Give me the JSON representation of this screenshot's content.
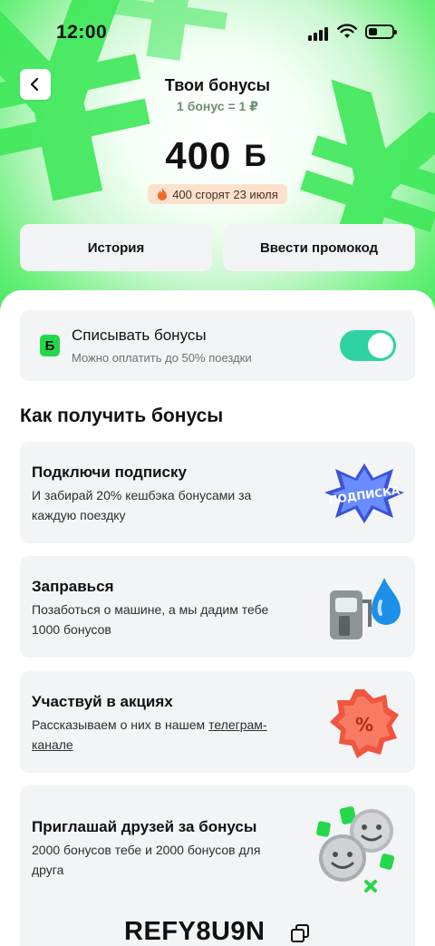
{
  "status_bar": {
    "time": "12:00"
  },
  "header": {
    "title": "Твои бонусы",
    "rate": "1 бонус = 1 ₽",
    "balance_amount": "400",
    "balance_currency": "Б",
    "expire_text": "400 сгорят 23 июля"
  },
  "actions": {
    "history": "История",
    "promocode": "Ввести промокод"
  },
  "toggle": {
    "title": "Списывать бонусы",
    "subtitle": "Можно оплатить до 50% поездки",
    "logo_letter": "Б",
    "enabled": true
  },
  "how_to": {
    "title": "Как получить бонусы",
    "cards": [
      {
        "title": "Подключи подписку",
        "text": "И забирай 20% кешбэка бонусами за каждую поездку",
        "illustration": "ПОДПИСКА"
      },
      {
        "title": "Заправься",
        "text": "Позаботься о машине, а мы дадим тебе 1000 бонусов"
      },
      {
        "title": "Участвуй в акциях",
        "text_before": "Рассказываем о них в нашем ",
        "link": "телеграм-канале",
        "badge": "%"
      },
      {
        "title": "Приглашай друзей за бонусы",
        "text": "2000 бонусов тебе и 2000 бонусов для друга",
        "promo_code": "REFY8U9N"
      }
    ]
  },
  "colors": {
    "accent_green": "#3ee859",
    "toggle_on": "#2ed3a1",
    "card_bg": "#f2f4f6",
    "expire_bg": "#fde1cf"
  }
}
